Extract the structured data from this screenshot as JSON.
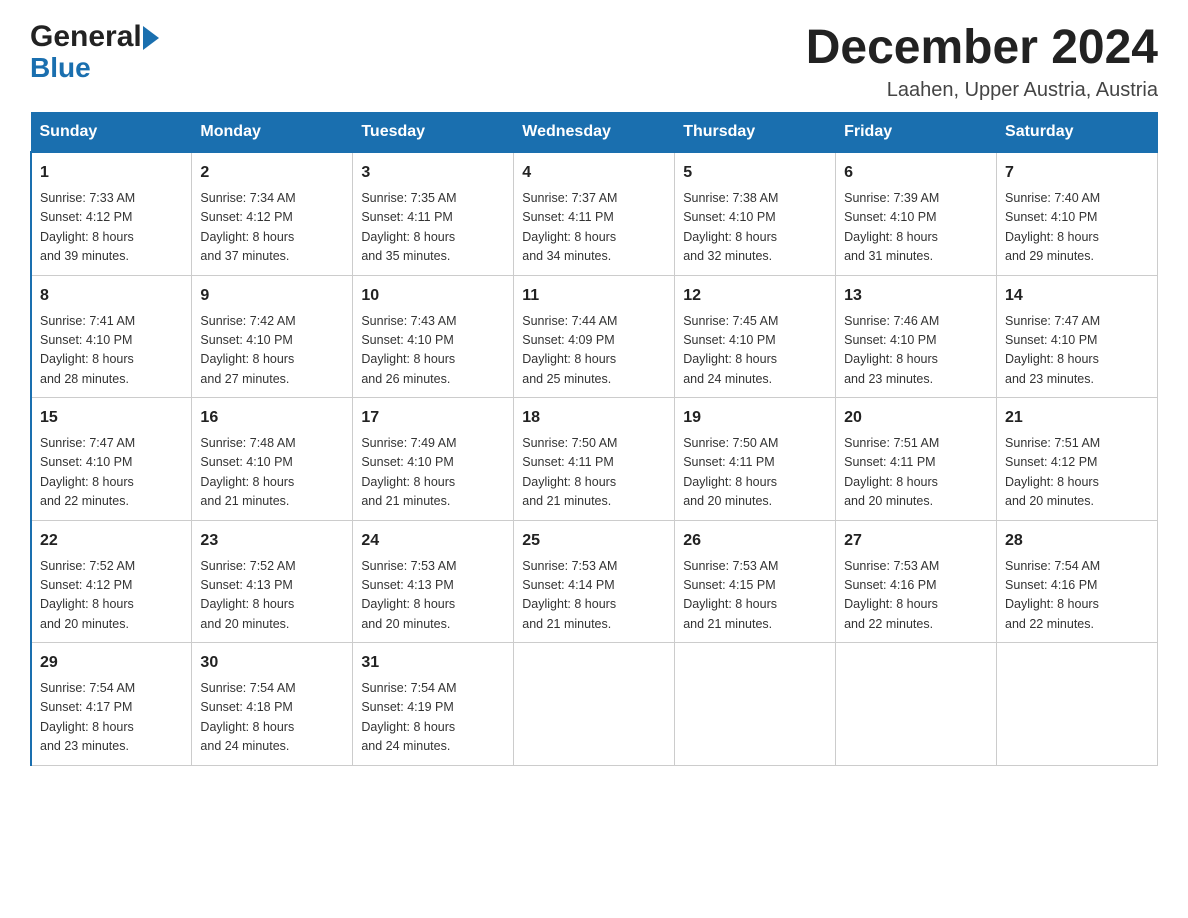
{
  "header": {
    "logo_general": "General",
    "logo_blue": "Blue",
    "month_year": "December 2024",
    "location": "Laahen, Upper Austria, Austria"
  },
  "weekdays": [
    "Sunday",
    "Monday",
    "Tuesday",
    "Wednesday",
    "Thursday",
    "Friday",
    "Saturday"
  ],
  "weeks": [
    [
      {
        "day": "1",
        "info": "Sunrise: 7:33 AM\nSunset: 4:12 PM\nDaylight: 8 hours\nand 39 minutes."
      },
      {
        "day": "2",
        "info": "Sunrise: 7:34 AM\nSunset: 4:12 PM\nDaylight: 8 hours\nand 37 minutes."
      },
      {
        "day": "3",
        "info": "Sunrise: 7:35 AM\nSunset: 4:11 PM\nDaylight: 8 hours\nand 35 minutes."
      },
      {
        "day": "4",
        "info": "Sunrise: 7:37 AM\nSunset: 4:11 PM\nDaylight: 8 hours\nand 34 minutes."
      },
      {
        "day": "5",
        "info": "Sunrise: 7:38 AM\nSunset: 4:10 PM\nDaylight: 8 hours\nand 32 minutes."
      },
      {
        "day": "6",
        "info": "Sunrise: 7:39 AM\nSunset: 4:10 PM\nDaylight: 8 hours\nand 31 minutes."
      },
      {
        "day": "7",
        "info": "Sunrise: 7:40 AM\nSunset: 4:10 PM\nDaylight: 8 hours\nand 29 minutes."
      }
    ],
    [
      {
        "day": "8",
        "info": "Sunrise: 7:41 AM\nSunset: 4:10 PM\nDaylight: 8 hours\nand 28 minutes."
      },
      {
        "day": "9",
        "info": "Sunrise: 7:42 AM\nSunset: 4:10 PM\nDaylight: 8 hours\nand 27 minutes."
      },
      {
        "day": "10",
        "info": "Sunrise: 7:43 AM\nSunset: 4:10 PM\nDaylight: 8 hours\nand 26 minutes."
      },
      {
        "day": "11",
        "info": "Sunrise: 7:44 AM\nSunset: 4:09 PM\nDaylight: 8 hours\nand 25 minutes."
      },
      {
        "day": "12",
        "info": "Sunrise: 7:45 AM\nSunset: 4:10 PM\nDaylight: 8 hours\nand 24 minutes."
      },
      {
        "day": "13",
        "info": "Sunrise: 7:46 AM\nSunset: 4:10 PM\nDaylight: 8 hours\nand 23 minutes."
      },
      {
        "day": "14",
        "info": "Sunrise: 7:47 AM\nSunset: 4:10 PM\nDaylight: 8 hours\nand 23 minutes."
      }
    ],
    [
      {
        "day": "15",
        "info": "Sunrise: 7:47 AM\nSunset: 4:10 PM\nDaylight: 8 hours\nand 22 minutes."
      },
      {
        "day": "16",
        "info": "Sunrise: 7:48 AM\nSunset: 4:10 PM\nDaylight: 8 hours\nand 21 minutes."
      },
      {
        "day": "17",
        "info": "Sunrise: 7:49 AM\nSunset: 4:10 PM\nDaylight: 8 hours\nand 21 minutes."
      },
      {
        "day": "18",
        "info": "Sunrise: 7:50 AM\nSunset: 4:11 PM\nDaylight: 8 hours\nand 21 minutes."
      },
      {
        "day": "19",
        "info": "Sunrise: 7:50 AM\nSunset: 4:11 PM\nDaylight: 8 hours\nand 20 minutes."
      },
      {
        "day": "20",
        "info": "Sunrise: 7:51 AM\nSunset: 4:11 PM\nDaylight: 8 hours\nand 20 minutes."
      },
      {
        "day": "21",
        "info": "Sunrise: 7:51 AM\nSunset: 4:12 PM\nDaylight: 8 hours\nand 20 minutes."
      }
    ],
    [
      {
        "day": "22",
        "info": "Sunrise: 7:52 AM\nSunset: 4:12 PM\nDaylight: 8 hours\nand 20 minutes."
      },
      {
        "day": "23",
        "info": "Sunrise: 7:52 AM\nSunset: 4:13 PM\nDaylight: 8 hours\nand 20 minutes."
      },
      {
        "day": "24",
        "info": "Sunrise: 7:53 AM\nSunset: 4:13 PM\nDaylight: 8 hours\nand 20 minutes."
      },
      {
        "day": "25",
        "info": "Sunrise: 7:53 AM\nSunset: 4:14 PM\nDaylight: 8 hours\nand 21 minutes."
      },
      {
        "day": "26",
        "info": "Sunrise: 7:53 AM\nSunset: 4:15 PM\nDaylight: 8 hours\nand 21 minutes."
      },
      {
        "day": "27",
        "info": "Sunrise: 7:53 AM\nSunset: 4:16 PM\nDaylight: 8 hours\nand 22 minutes."
      },
      {
        "day": "28",
        "info": "Sunrise: 7:54 AM\nSunset: 4:16 PM\nDaylight: 8 hours\nand 22 minutes."
      }
    ],
    [
      {
        "day": "29",
        "info": "Sunrise: 7:54 AM\nSunset: 4:17 PM\nDaylight: 8 hours\nand 23 minutes."
      },
      {
        "day": "30",
        "info": "Sunrise: 7:54 AM\nSunset: 4:18 PM\nDaylight: 8 hours\nand 24 minutes."
      },
      {
        "day": "31",
        "info": "Sunrise: 7:54 AM\nSunset: 4:19 PM\nDaylight: 8 hours\nand 24 minutes."
      },
      null,
      null,
      null,
      null
    ]
  ]
}
